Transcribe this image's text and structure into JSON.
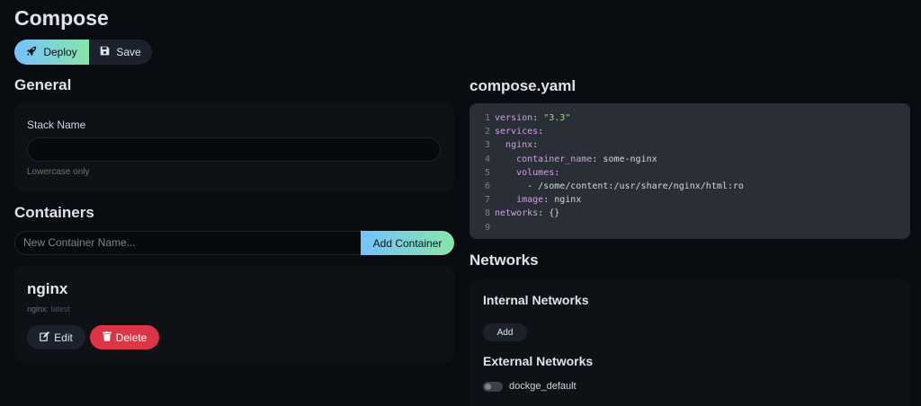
{
  "page": {
    "title": "Compose"
  },
  "toolbar": {
    "deploy_label": "Deploy",
    "save_label": "Save"
  },
  "general": {
    "heading": "General",
    "stack_name_label": "Stack Name",
    "stack_name_value": "",
    "hint": "Lowercase only"
  },
  "containers": {
    "heading": "Containers",
    "new_placeholder": "New Container Name...",
    "add_label": "Add Container",
    "items": [
      {
        "name": "nginx",
        "image": "nginx:",
        "tag": "latest",
        "edit_label": "Edit",
        "delete_label": "Delete"
      }
    ]
  },
  "compose": {
    "heading": "compose.yaml",
    "lines": [
      {
        "n": "1",
        "parts": [
          [
            "k",
            "version"
          ],
          [
            "p",
            ": "
          ],
          [
            "s",
            "\"3.3\""
          ]
        ]
      },
      {
        "n": "2",
        "parts": [
          [
            "k",
            "services"
          ],
          [
            "p",
            ":"
          ]
        ]
      },
      {
        "n": "3",
        "parts": [
          [
            "p",
            "  "
          ],
          [
            "k",
            "nginx"
          ],
          [
            "p",
            ":"
          ]
        ]
      },
      {
        "n": "4",
        "parts": [
          [
            "p",
            "    "
          ],
          [
            "k",
            "container_name"
          ],
          [
            "p",
            ": some-nginx"
          ]
        ]
      },
      {
        "n": "5",
        "parts": [
          [
            "p",
            "    "
          ],
          [
            "k",
            "volumes"
          ],
          [
            "p",
            ":"
          ]
        ]
      },
      {
        "n": "6",
        "parts": [
          [
            "p",
            "      - /some/content:/usr/share/nginx/html:ro"
          ]
        ]
      },
      {
        "n": "7",
        "parts": [
          [
            "p",
            "    "
          ],
          [
            "k",
            "image"
          ],
          [
            "p",
            ": nginx"
          ]
        ]
      },
      {
        "n": "8",
        "parts": [
          [
            "k",
            "networks"
          ],
          [
            "p",
            ": {}"
          ]
        ]
      },
      {
        "n": "9",
        "parts": []
      }
    ]
  },
  "networks": {
    "heading": "Networks",
    "internal_heading": "Internal Networks",
    "add_label": "Add",
    "external_heading": "External Networks",
    "external": [
      {
        "name": "dockge_default",
        "enabled": false
      }
    ]
  },
  "colors": {
    "accent_start": "#74c2ff",
    "accent_end": "#86e6a9",
    "danger": "#dc3545",
    "background": "#090c10"
  },
  "icons": {
    "deploy": "rocket-icon",
    "save": "floppy-disk-icon",
    "edit": "edit-icon",
    "delete": "trash-icon"
  }
}
